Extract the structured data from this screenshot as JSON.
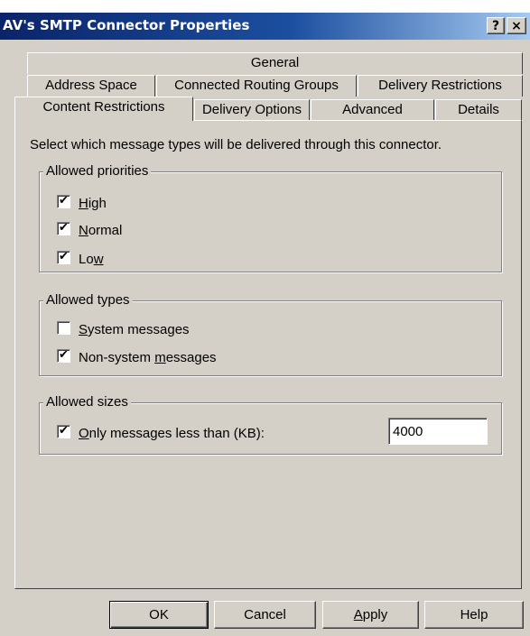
{
  "window": {
    "title": "AV's SMTP Connector Properties",
    "help_glyph": "?",
    "close_glyph": "×"
  },
  "tabs": {
    "row1": [
      {
        "label": "General"
      }
    ],
    "row2": [
      {
        "label": "Address Space"
      },
      {
        "label": "Connected Routing Groups"
      },
      {
        "label": "Delivery Restrictions"
      }
    ],
    "row3": [
      {
        "label": "Content Restrictions",
        "active": true
      },
      {
        "label": "Delivery Options"
      },
      {
        "label": "Advanced"
      },
      {
        "label": "Details"
      }
    ]
  },
  "content": {
    "intro": "Select which message types will be delivered through this connector.",
    "priorities": {
      "legend": "Allowed priorities",
      "items": [
        {
          "pre": "",
          "ul": "H",
          "post": "igh",
          "checked": true
        },
        {
          "pre": "",
          "ul": "N",
          "post": "ormal",
          "checked": true
        },
        {
          "pre": "Lo",
          "ul": "w",
          "post": "",
          "checked": true
        }
      ]
    },
    "types": {
      "legend": "Allowed types",
      "items": [
        {
          "pre": "",
          "ul": "S",
          "post": "ystem messages",
          "checked": false
        },
        {
          "pre": "Non-system ",
          "ul": "m",
          "post": "essages",
          "checked": true
        }
      ]
    },
    "sizes": {
      "legend": "Allowed sizes",
      "item": {
        "pre": "",
        "ul": "O",
        "post": "nly messages less than (KB):",
        "checked": true
      },
      "value": "4000"
    }
  },
  "buttons": {
    "ok": "OK",
    "cancel": "Cancel",
    "apply_ul": "A",
    "apply_rest": "pply",
    "help": "Help"
  },
  "colors": {
    "face": "#d4d0c8",
    "title_start": "#0a246a",
    "title_end": "#a6caf0"
  }
}
